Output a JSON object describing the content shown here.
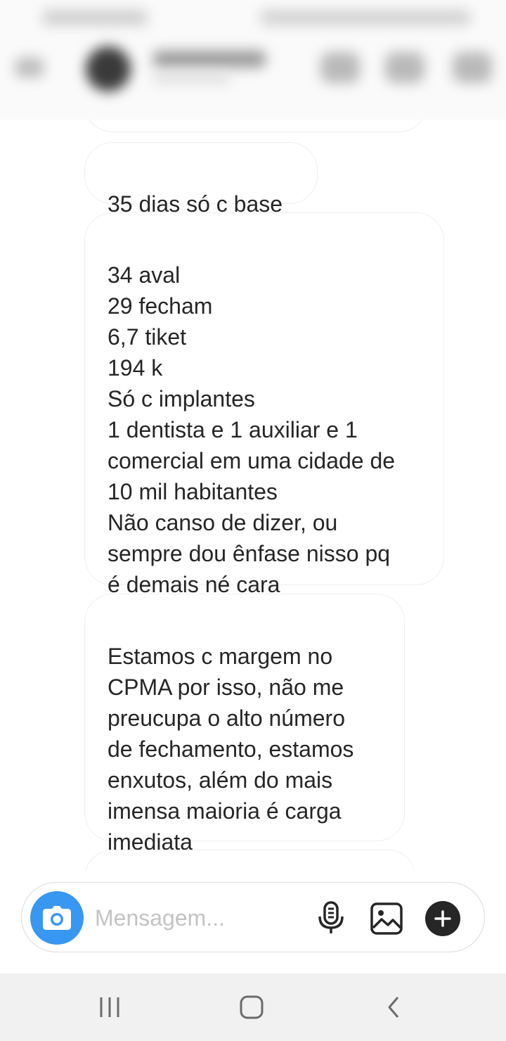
{
  "messages": [
    {
      "text": ""
    },
    {
      "text": "35 dias só c base"
    },
    {
      "text": "34 aval\n29 fecham\n6,7 tiket\n194 k\nSó c implantes\n1 dentista e 1 auxiliar e 1\ncomercial em uma cidade de\n10 mil habitantes\nNão canso de dizer, ou\nsempre dou ênfase nisso pq\né demais né cara"
    },
    {
      "text": "Estamos c margem no\nCPMA por isso, não me\npreucupa o alto número\nde fechamento, estamos\nenxutos, além do mais\nimensa maioria é carga\nimediata"
    },
    {
      "text": ""
    }
  ],
  "composer": {
    "placeholder": "Mensagem...",
    "camera_icon": "camera-icon",
    "mic_icon": "microphone-icon",
    "gallery_icon": "image-icon",
    "plus_icon": "plus-icon"
  },
  "navbar": {
    "icons": [
      "recent-apps-icon",
      "home-icon",
      "back-icon"
    ]
  },
  "colors": {
    "accent": "#3897f0",
    "bubble_border": "#efefef",
    "text": "#262626",
    "placeholder": "#c3c3c3",
    "navbar": "#f1f1f1"
  }
}
